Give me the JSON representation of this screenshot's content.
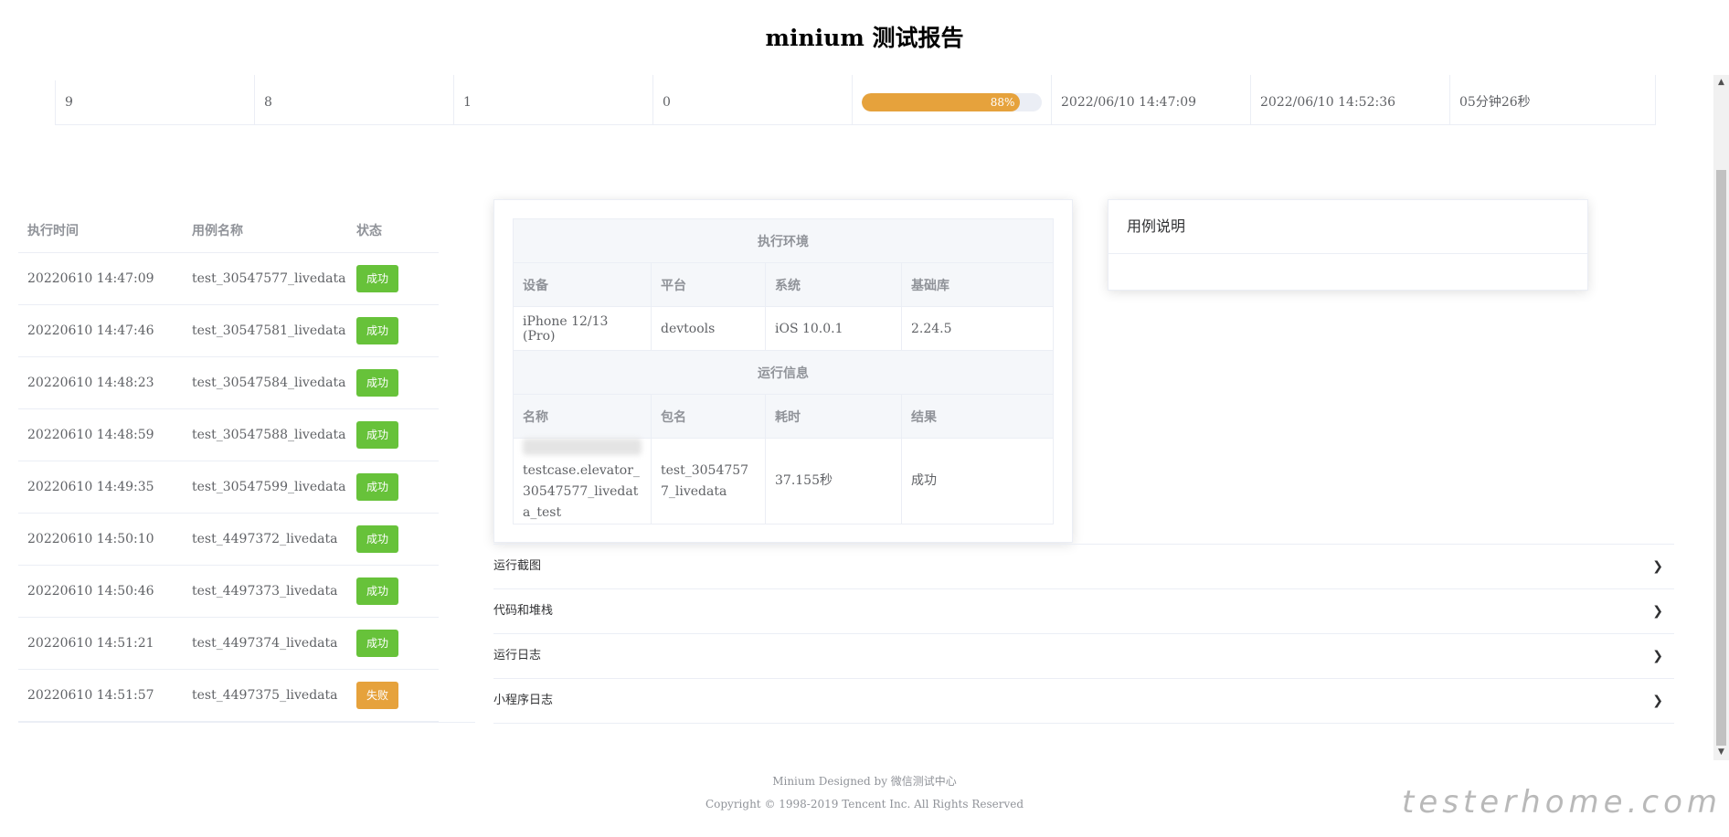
{
  "page": {
    "title": "minium 测试报告"
  },
  "summary": {
    "total": "9",
    "passed": "8",
    "failed": "1",
    "skipped": "0",
    "progress_label": "88%",
    "progress_value": 0.88,
    "start_time": "2022/06/10 14:47:09",
    "end_time": "2022/06/10 14:52:36",
    "duration": "05分钟26秒",
    "progress_color": "#e6a23c"
  },
  "cases": {
    "headers": {
      "time": "执行时间",
      "name": "用例名称",
      "status": "状态"
    },
    "rows": [
      {
        "time": "20220610 14:47:09",
        "name": "test_30547577_livedata",
        "status": "成功",
        "state": "ok"
      },
      {
        "time": "20220610 14:47:46",
        "name": "test_30547581_livedata",
        "status": "成功",
        "state": "ok"
      },
      {
        "time": "20220610 14:48:23",
        "name": "test_30547584_livedata",
        "status": "成功",
        "state": "ok"
      },
      {
        "time": "20220610 14:48:59",
        "name": "test_30547588_livedata",
        "status": "成功",
        "state": "ok"
      },
      {
        "time": "20220610 14:49:35",
        "name": "test_30547599_livedata",
        "status": "成功",
        "state": "ok"
      },
      {
        "time": "20220610 14:50:10",
        "name": "test_4497372_livedata",
        "status": "成功",
        "state": "ok"
      },
      {
        "time": "20220610 14:50:46",
        "name": "test_4497373_livedata",
        "status": "成功",
        "state": "ok"
      },
      {
        "time": "20220610 14:51:21",
        "name": "test_4497374_livedata",
        "status": "成功",
        "state": "ok"
      },
      {
        "time": "20220610 14:51:57",
        "name": "test_4497375_livedata",
        "status": "失败",
        "state": "fail"
      }
    ],
    "success_color": "#67c23a",
    "fail_color": "#e6a23c"
  },
  "env": {
    "section_title": "执行环境",
    "headers": {
      "device": "设备",
      "platform": "平台",
      "system": "系统",
      "base_lib": "基础库"
    },
    "values": {
      "device": "iPhone 12/13 (Pro)",
      "platform": "devtools",
      "system": "iOS 10.0.1",
      "base_lib": "2.24.5"
    }
  },
  "run": {
    "section_title": "运行信息",
    "headers": {
      "name": "名称",
      "package": "包名",
      "elapsed": "耗时",
      "result": "结果"
    },
    "values": {
      "name": "testcase.elevator_30547577_livedata_test",
      "package": "test_30547577_livedata",
      "elapsed": "37.155秒",
      "result": "成功"
    }
  },
  "desc": {
    "title": "用例说明"
  },
  "collapse": [
    {
      "label": "运行截图"
    },
    {
      "label": "代码和堆栈"
    },
    {
      "label": "运行日志"
    },
    {
      "label": "小程序日志"
    }
  ],
  "footer": {
    "line1": "Minium Designed by 微信测试中心",
    "line2": "Copyright © 1998-2019 Tencent Inc. All Rights Reserved"
  },
  "watermark": "testerhome.com"
}
